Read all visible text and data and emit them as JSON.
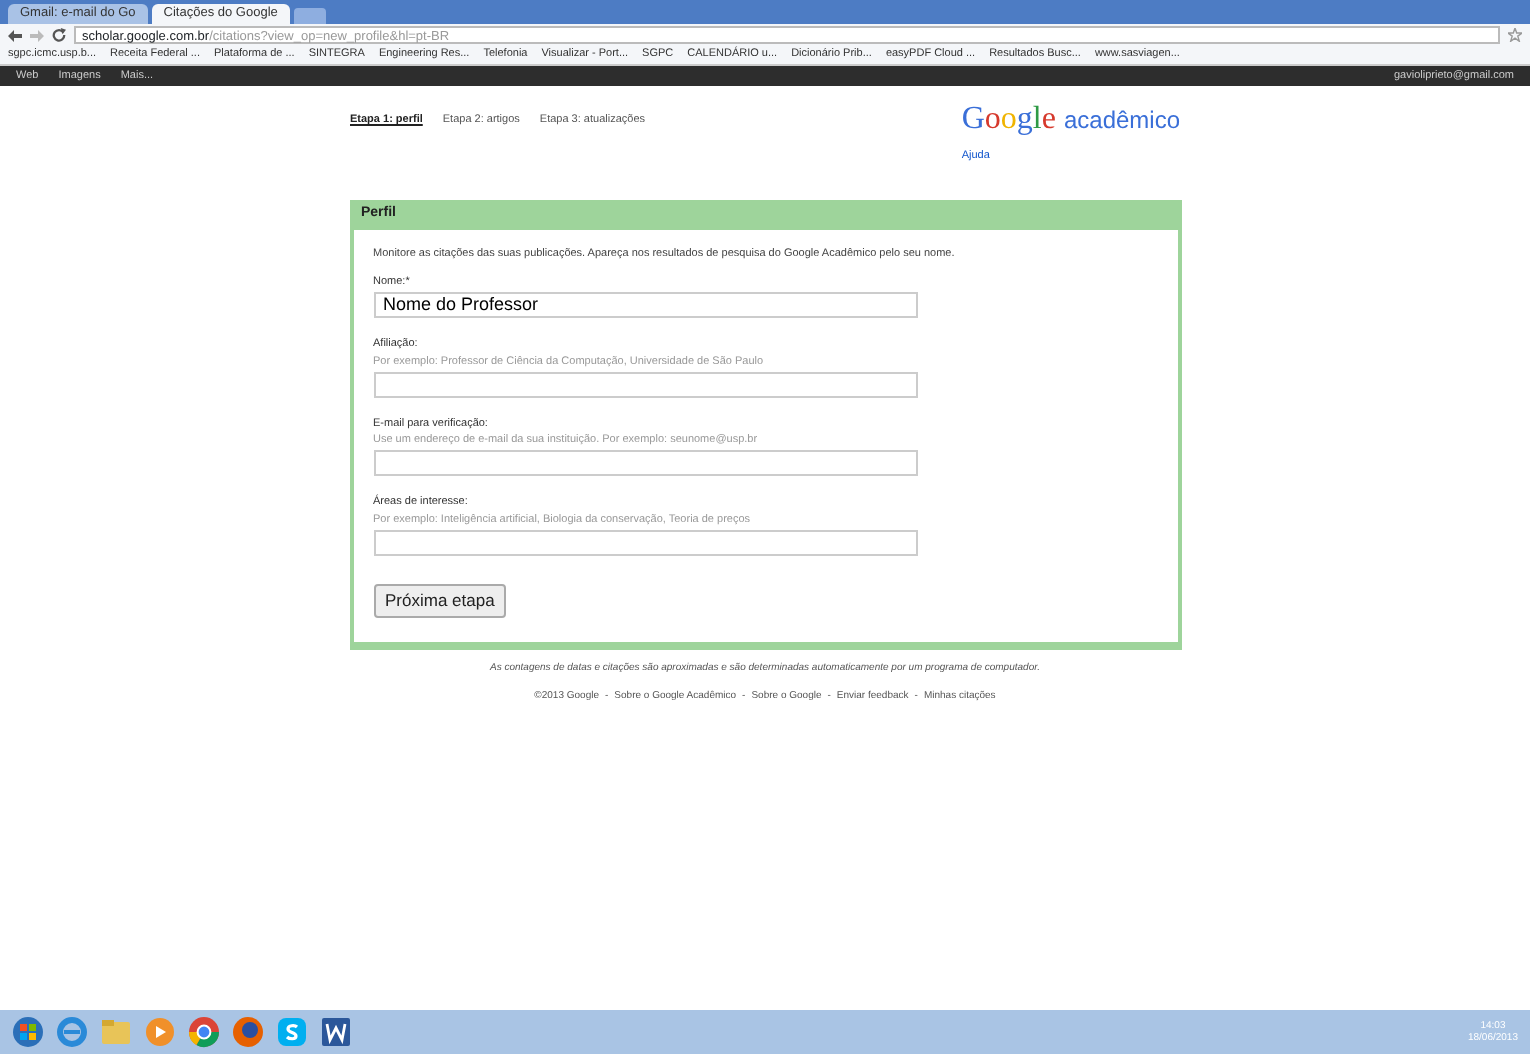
{
  "browser": {
    "tabs": [
      {
        "title": "Gmail: e-mail do Go",
        "selected": false
      },
      {
        "title": "Citações do Google",
        "selected": true
      }
    ],
    "address": {
      "host": "scholar.google.com.br",
      "path": "/citations?view_op=new_profile&hl=pt-BR"
    },
    "bookmarks": [
      "sgpc.icmc.usp.b...",
      "Receita Federal ...",
      "Plataforma de ...",
      "SINTEGRA",
      "Engineering Res...",
      "Telefonia",
      "Visualizar - Port...",
      "SGPC",
      "CALENDÁRIO u...",
      "Dicionário Prib...",
      "easyPDF Cloud ...",
      "Resultados Busc...",
      "www.sasviagen..."
    ]
  },
  "google_bar": {
    "links": [
      "Web",
      "Imagens",
      "Mais..."
    ],
    "account": "gavioliprieto@gmail.com"
  },
  "steps": [
    {
      "label": "Etapa 1: perfil",
      "selected": true
    },
    {
      "label": "Etapa 2: artigos",
      "selected": false
    },
    {
      "label": "Etapa 3: atualizações",
      "selected": false
    }
  ],
  "logo": {
    "brand": "Google",
    "product": "acadêmico"
  },
  "help_link": "Ajuda",
  "panel": {
    "title": "Perfil",
    "intro": "Monitore as citações das suas publicações. Apareça nos resultados de pesquisa do Google Acadêmico pelo seu nome.",
    "fields": [
      {
        "label": "Nome:*",
        "value": "Nome do Professor"
      },
      {
        "label": "Afiliação:",
        "hint": "Por exemplo: Professor de Ciência da Computação, Universidade de São Paulo"
      },
      {
        "label": "E-mail para verificação:",
        "hint": "Use um endereço de e-mail da sua instituição. Por exemplo: seunome@usp.br"
      },
      {
        "label": "Áreas de interesse:",
        "hint": "Por exemplo: Inteligência artificial, Biologia da conservação, Teoria de preços"
      }
    ],
    "button": "Próxima etapa"
  },
  "footer": {
    "note": "As contagens de datas e citações são aproximadas e são determinadas automaticamente por um programa de computador.",
    "copyright": "©2013 Google",
    "links": [
      {
        "separator": "-",
        "label": "Sobre o Google Acadêmico"
      },
      {
        "separator": "-",
        "label": "Sobre o Google"
      },
      {
        "separator": "-",
        "label": "Enviar feedback"
      },
      {
        "separator": "-",
        "label": "Minhas citações"
      }
    ]
  },
  "taskbar": {
    "apps": [
      {
        "kind": "start"
      },
      {
        "kind": "ie"
      },
      {
        "kind": "folder"
      },
      {
        "kind": "media"
      },
      {
        "kind": "chrome"
      },
      {
        "kind": "firefox"
      },
      {
        "kind": "skype"
      },
      {
        "kind": "word"
      }
    ],
    "time": "14:03",
    "date": "18/06/2013"
  }
}
